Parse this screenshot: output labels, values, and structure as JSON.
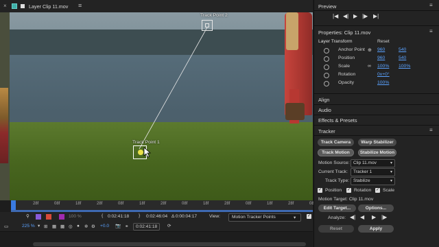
{
  "layer_tab": {
    "close": "×",
    "title": "Layer Clip 11.mov",
    "menu": "≡"
  },
  "viewer": {
    "track_point_2": "Track Point 2",
    "track_point_1": "Track Point 1"
  },
  "ruler": {
    "ticks": [
      "28f",
      "08f",
      "18f",
      "28f",
      "08f",
      "18f",
      "28f",
      "08f",
      "18f",
      "28f",
      "08f",
      "18f",
      "28f",
      "08f"
    ]
  },
  "controls_row1": {
    "in_time": "0:02:41:18",
    "out_time": "0:02:46:04",
    "duration": "Δ 0:00:04:17",
    "view_label": "View:",
    "view_value": "Motion Tracker Points"
  },
  "controls_row2": {
    "zoom": "225 %",
    "exposure": "+0.0",
    "current_time": "0:02:41:18",
    "opacity": "100 %"
  },
  "preview": {
    "title": "Preview",
    "menu": "≡"
  },
  "properties": {
    "title": "Properties: Clip 11.mov",
    "menu": "≡",
    "section": "Layer Transform",
    "reset": "Reset",
    "rows": [
      {
        "label": "Anchor Point",
        "v1": "960",
        "v2": "540"
      },
      {
        "label": "Position",
        "v1": "960",
        "v2": "540"
      },
      {
        "label": "Scale",
        "v1": "100%",
        "v2": "100%"
      },
      {
        "label": "Rotation",
        "v1": "0x+0°",
        "v2": ""
      },
      {
        "label": "Opacity",
        "v1": "100%",
        "v2": ""
      }
    ]
  },
  "panels": {
    "align": "Align",
    "audio": "Audio",
    "effects": "Effects & Presets"
  },
  "tracker": {
    "title": "Tracker",
    "menu": "≡",
    "track_camera": "Track Camera",
    "warp_stabilizer": "Warp Stabilizer",
    "track_motion": "Track Motion",
    "stabilize_motion": "Stabilize Motion",
    "motion_source_label": "Motion Source:",
    "motion_source": "Clip 11.mov",
    "current_track_label": "Current Track:",
    "current_track": "Tracker 1",
    "track_type_label": "Track Type:",
    "track_type": "Stabilize",
    "position": "Position",
    "rotation": "Rotation",
    "scale": "Scale",
    "motion_target": "Motion Target: Clip 11.mov",
    "edit_target": "Edit Target...",
    "options": "Options...",
    "analyze": "Analyze:",
    "reset": "Reset",
    "apply": "Apply"
  },
  "colors": {
    "accent": "#5aa2ff",
    "playhead": "#3a7be0",
    "track_point": "#e8e04a"
  }
}
